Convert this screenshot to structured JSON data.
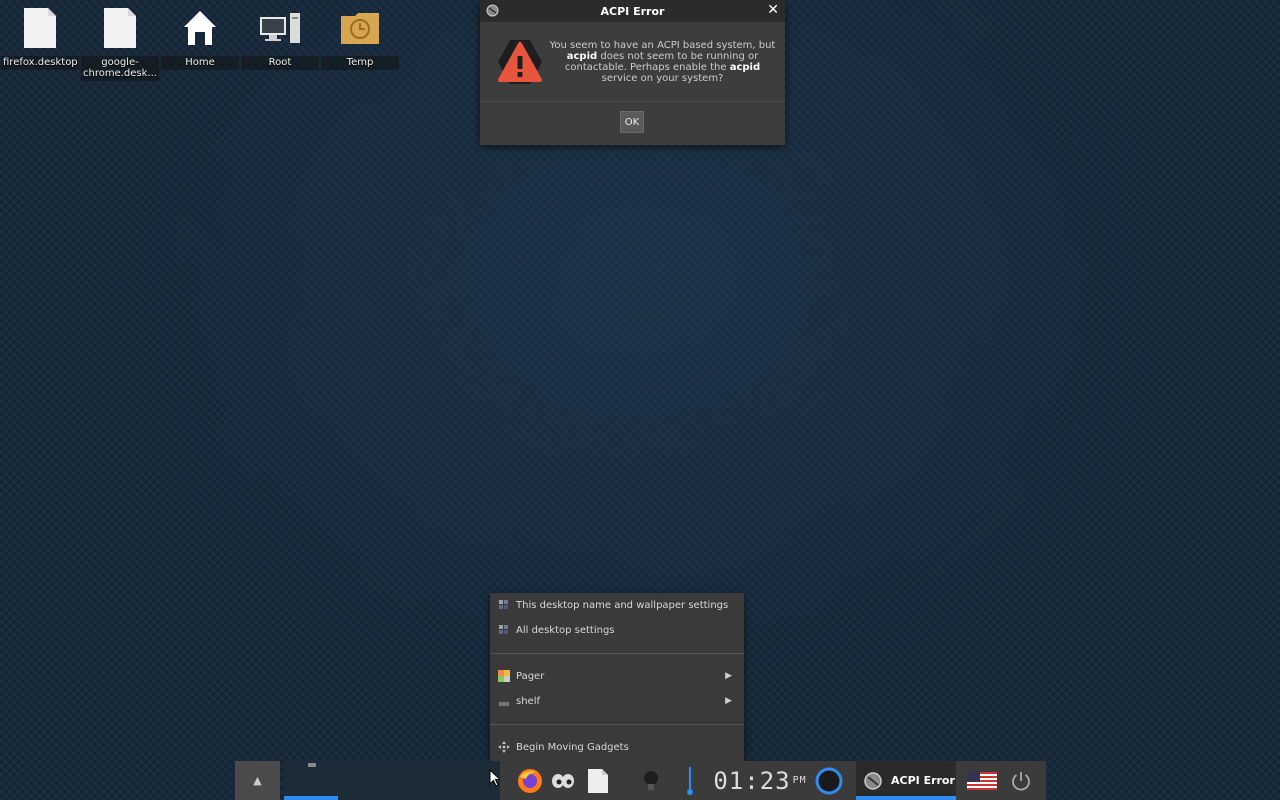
{
  "desktop": {
    "icons": [
      {
        "label": "firefox.desktop",
        "icon": "file-icon"
      },
      {
        "label": "google-chrome.desk...",
        "icon": "file-icon"
      },
      {
        "label": "Home",
        "icon": "home-icon"
      },
      {
        "label": "Root",
        "icon": "computer-icon"
      },
      {
        "label": "Temp",
        "icon": "clock-folder-icon"
      }
    ]
  },
  "dialog": {
    "title": "ACPI Error",
    "message_parts": {
      "p1": "You seem to have an ACPI based system, but",
      "b1": "acpid",
      "p2": " does not seem to be running or contactable. Perhaps enable the ",
      "b2": "acpid",
      "p3": " service on your system?"
    },
    "ok_label": "OK"
  },
  "context_menu": {
    "items": [
      "This desktop name and wallpaper settings",
      "All desktop settings",
      "Pager",
      "shelf",
      "Begin Moving Gadgets"
    ]
  },
  "shelf": {
    "clock": {
      "time": "01:23",
      "ampm": "PM"
    },
    "task_label": "ACPI Error"
  },
  "colors": {
    "accent": "#2f8cf0",
    "warning": "#e8553d"
  }
}
